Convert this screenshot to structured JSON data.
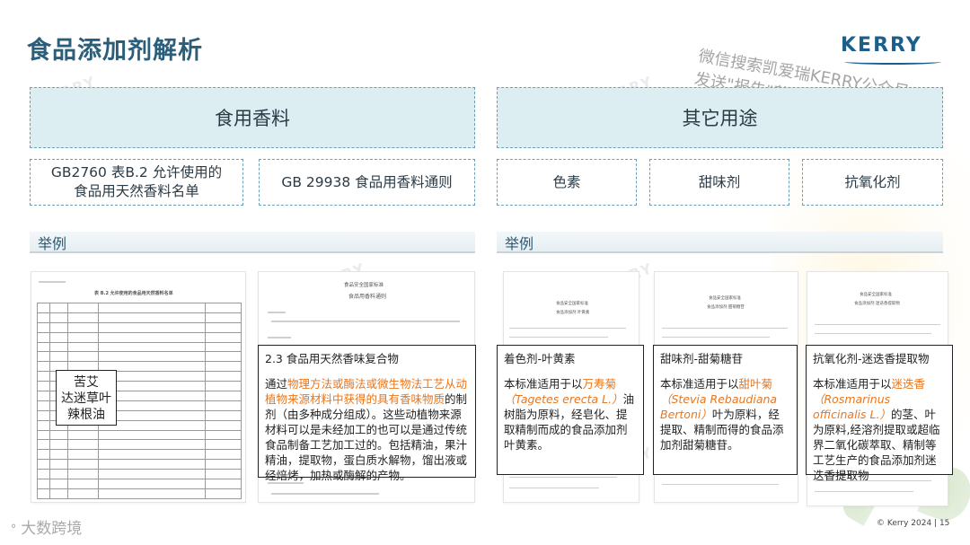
{
  "title": "食品添加剂解析",
  "logo": "KERRY",
  "watermark_lines": [
    "微信搜索凯爱瑞KERRY公众号",
    "发送\"报告\"获取本资料"
  ],
  "left_category": "食用香料",
  "right_category": "其它用途",
  "left_sub": [
    {
      "line1": "GB2760 表B.2 允许使用的",
      "line2": "食品用天然香料名单"
    },
    {
      "text": "GB 29938 食品用香料通则"
    }
  ],
  "right_sub": [
    "色素",
    "甜味剂",
    "抗氧化剂"
  ],
  "example_label": "举例",
  "docs": {
    "gb2760_title": "表 B.2 允许使用的食品用天然香料名单",
    "gb29938_header": "食品安全国家标准",
    "gb29938_title": "食品用香料通则",
    "pigment_title": "食品安全国家标准",
    "pigment_sub": "食品添加剂 叶黄素",
    "sweet_title": "食品安全国家标准",
    "sweet_sub": "食品添加剂 甜菊糖苷",
    "anti_title": "食品安全国家标准",
    "anti_sub": "食品添加剂 迷迭香提取物"
  },
  "callout_herbs": [
    "苦艾",
    "达迷草叶",
    "辣根油"
  ],
  "note_gb29938": {
    "heading": "2.3 食品用天然香味复合物",
    "p_pre": "通过",
    "p_hl": "物理方法或酶法或微生物法工艺从动植物来源材料中获得的具有香味物质",
    "p_post": "的制剂（由多种成分组成）。这些动植物来源材料可以是未经加工的也可以是通过传统食品制备工艺加工过的。包括精油，果汁精油，提取物，蛋白质水解物，馏出液或经焙烤，加热或酶解的产物。"
  },
  "note_pigment": {
    "heading": "着色剂-叶黄素",
    "p_pre": "本标准适用于以",
    "p_hl": "万寿菊",
    "p_latin": "（Tagetes erecta L.）",
    "p_post": "油树脂为原料，经皂化、提取精制而成的食品添加剂叶黄素。"
  },
  "note_sweet": {
    "heading": "甜味剂-甜菊糖苷",
    "p_pre": "本标准适用于以",
    "p_hl": "甜叶菊",
    "p_latin": "（Stevia Rebaudiana Bertoni）",
    "p_post": "叶为原料，经提取、精制而得的食品添加剂甜菊糖苷。"
  },
  "note_anti": {
    "heading": "抗氧化剂-迷迭香提取物",
    "p_pre": "本标准适用于以",
    "p_hl": "迷迭香",
    "p_latin": "（Rosmarinus officinalis L.）",
    "p_post": "的茎、叶为原料,经溶剂提取或超临界二氧化碳萃取、精制等工艺生产的食品添加剂迷迭香提取物"
  },
  "bottom_logo": "大数跨境",
  "footer": "© Kerry 2024 | 15",
  "colors": {
    "title": "#2a5e7a",
    "highlight": "#e8761e",
    "category_bg": "#ddeef3",
    "dash": "#6d9fb5"
  }
}
